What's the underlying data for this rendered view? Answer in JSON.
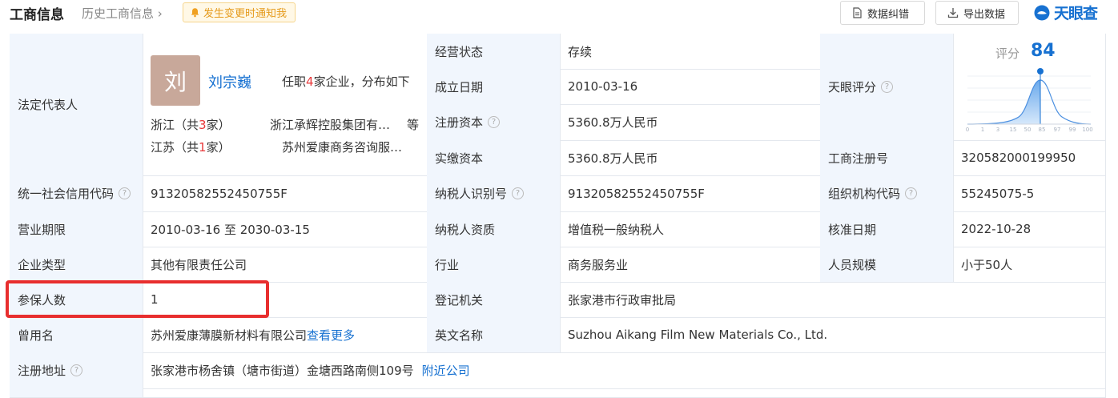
{
  "header": {
    "title": "工商信息",
    "history_link": "历史工商信息",
    "notify_label": "发生变更时通知我",
    "correct_label": "数据纠错",
    "export_label": "导出数据",
    "logo_text": "天眼查",
    "accent_color": "#1771d1"
  },
  "legal_rep": {
    "label": "法定代表人",
    "avatar_char": "刘",
    "name": "刘宗巍",
    "summary_prefix": "任职",
    "summary_count": "4",
    "summary_suffix": "家企业，分布如下",
    "regions": [
      {
        "prefix": "浙江（共",
        "count": "3",
        "suffix": "家）",
        "company": "浙江承辉控股集团有…",
        "more": "等"
      },
      {
        "prefix": "江苏（共",
        "count": "1",
        "suffix": "家）",
        "company": "苏州爱康商务咨询服…",
        "more": ""
      }
    ]
  },
  "fields": {
    "status_label": "经营状态",
    "status": "存续",
    "founded_label": "成立日期",
    "founded": "2010-03-16",
    "reg_capital_label": "注册资本",
    "reg_capital": "5360.8万人民币",
    "paid_capital_label": "实缴资本",
    "paid_capital": "5360.8万人民币",
    "rating_label": "天眼评分",
    "reg_no_label": "工商注册号",
    "reg_no": "320582000199950",
    "credit_code_label": "统一社会信用代码",
    "credit_code": "91320582552450755F",
    "taxpayer_id_label": "纳税人识别号",
    "taxpayer_id": "91320582552450755F",
    "org_code_label": "组织机构代码",
    "org_code": "55245075-5",
    "term_label": "营业期限",
    "term": "2010-03-16 至 2030-03-15",
    "taxpayer_qual_label": "纳税人资质",
    "taxpayer_qual": "增值税一般纳税人",
    "approve_date_label": "核准日期",
    "approve_date": "2022-10-28",
    "type_label": "企业类型",
    "type": "其他有限责任公司",
    "industry_label": "行业",
    "industry": "商务服务业",
    "staff_label": "人员规模",
    "staff": "小于50人",
    "insured_label": "参保人数",
    "insured": "1",
    "authority_label": "登记机关",
    "authority": "张家港市行政审批局",
    "former_name_label": "曾用名",
    "former_name": "苏州爱康薄膜新材料有限公司",
    "former_more": "查看更多",
    "english_label": "英文名称",
    "english": "Suzhou Aikang Film New Materials Co., Ltd.",
    "address_label": "注册地址",
    "address": "张家港市杨舍镇（塘市街道）金塘西路南侧109号",
    "nearby": "附近公司"
  },
  "score": {
    "label": "评分",
    "value": "84",
    "ticks": [
      "0",
      "1",
      "3",
      "15",
      "50",
      "85",
      "97",
      "99",
      "100"
    ]
  },
  "highlight_color": "#e82e2e"
}
